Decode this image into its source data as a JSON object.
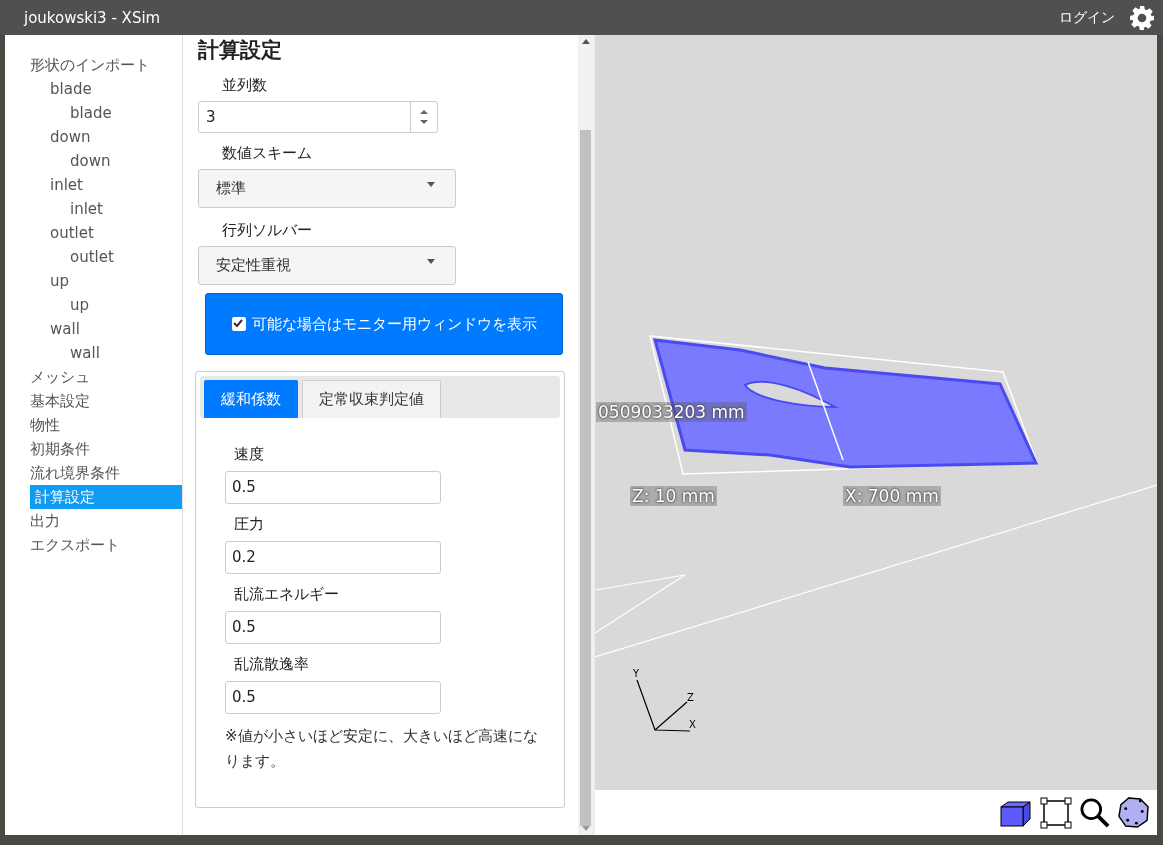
{
  "window": {
    "title": "joukowski3 - XSim"
  },
  "header": {
    "login": "ログイン"
  },
  "sidebar": {
    "items": [
      {
        "label": "形状のインポート",
        "selected": false,
        "children": [
          {
            "label": "blade",
            "selected": false,
            "children": [
              {
                "label": "blade",
                "selected": false
              }
            ]
          },
          {
            "label": "down",
            "selected": false,
            "children": [
              {
                "label": "down",
                "selected": false
              }
            ]
          },
          {
            "label": "inlet",
            "selected": false,
            "children": [
              {
                "label": "inlet",
                "selected": false
              }
            ]
          },
          {
            "label": "outlet",
            "selected": false,
            "children": [
              {
                "label": "outlet",
                "selected": false
              }
            ]
          },
          {
            "label": "up",
            "selected": false,
            "children": [
              {
                "label": "up",
                "selected": false
              }
            ]
          },
          {
            "label": "wall",
            "selected": false,
            "children": [
              {
                "label": "wall",
                "selected": false
              }
            ]
          }
        ]
      },
      {
        "label": "メッシュ",
        "selected": false
      },
      {
        "label": "基本設定",
        "selected": false
      },
      {
        "label": "物性",
        "selected": false
      },
      {
        "label": "初期条件",
        "selected": false
      },
      {
        "label": "流れ境界条件",
        "selected": false
      },
      {
        "label": "計算設定",
        "selected": true
      },
      {
        "label": "出力",
        "selected": false
      },
      {
        "label": "エクスポート",
        "selected": false
      }
    ]
  },
  "panel": {
    "title": "計算設定",
    "fields": [
      {
        "kind": "number",
        "label": "並列数",
        "value": "3"
      },
      {
        "kind": "select",
        "label": "数値スキーム",
        "value": "標準"
      },
      {
        "kind": "select",
        "label": "行列ソルバー",
        "value": "安定性重視"
      }
    ],
    "monitor_option": {
      "label": "可能な場合はモニター用ウィンドウを表示",
      "checked": true
    },
    "tabs": [
      {
        "label": "緩和係数",
        "selected": true
      },
      {
        "label": "定常収束判定値",
        "selected": false
      }
    ],
    "tab_fields": [
      {
        "label": "速度",
        "value": "0.5"
      },
      {
        "label": "圧力",
        "value": "0.2"
      },
      {
        "label": "乱流エネルギー",
        "value": "0.5"
      },
      {
        "label": "乱流散逸率",
        "value": "0.5"
      }
    ],
    "note": "※値が小さいほど安定に、大きいほど高速になります。"
  },
  "viewport": {
    "dimension_labels": [
      {
        "kind": "y",
        "text": "0509033203 mm"
      },
      {
        "kind": "z",
        "text": "Z: 10 mm"
      },
      {
        "kind": "x",
        "text": "X: 700 mm"
      }
    ],
    "axis_labels": [
      {
        "kind": "y",
        "text": "Y"
      },
      {
        "kind": "z",
        "text": "Z"
      },
      {
        "kind": "x",
        "text": "X"
      }
    ]
  }
}
